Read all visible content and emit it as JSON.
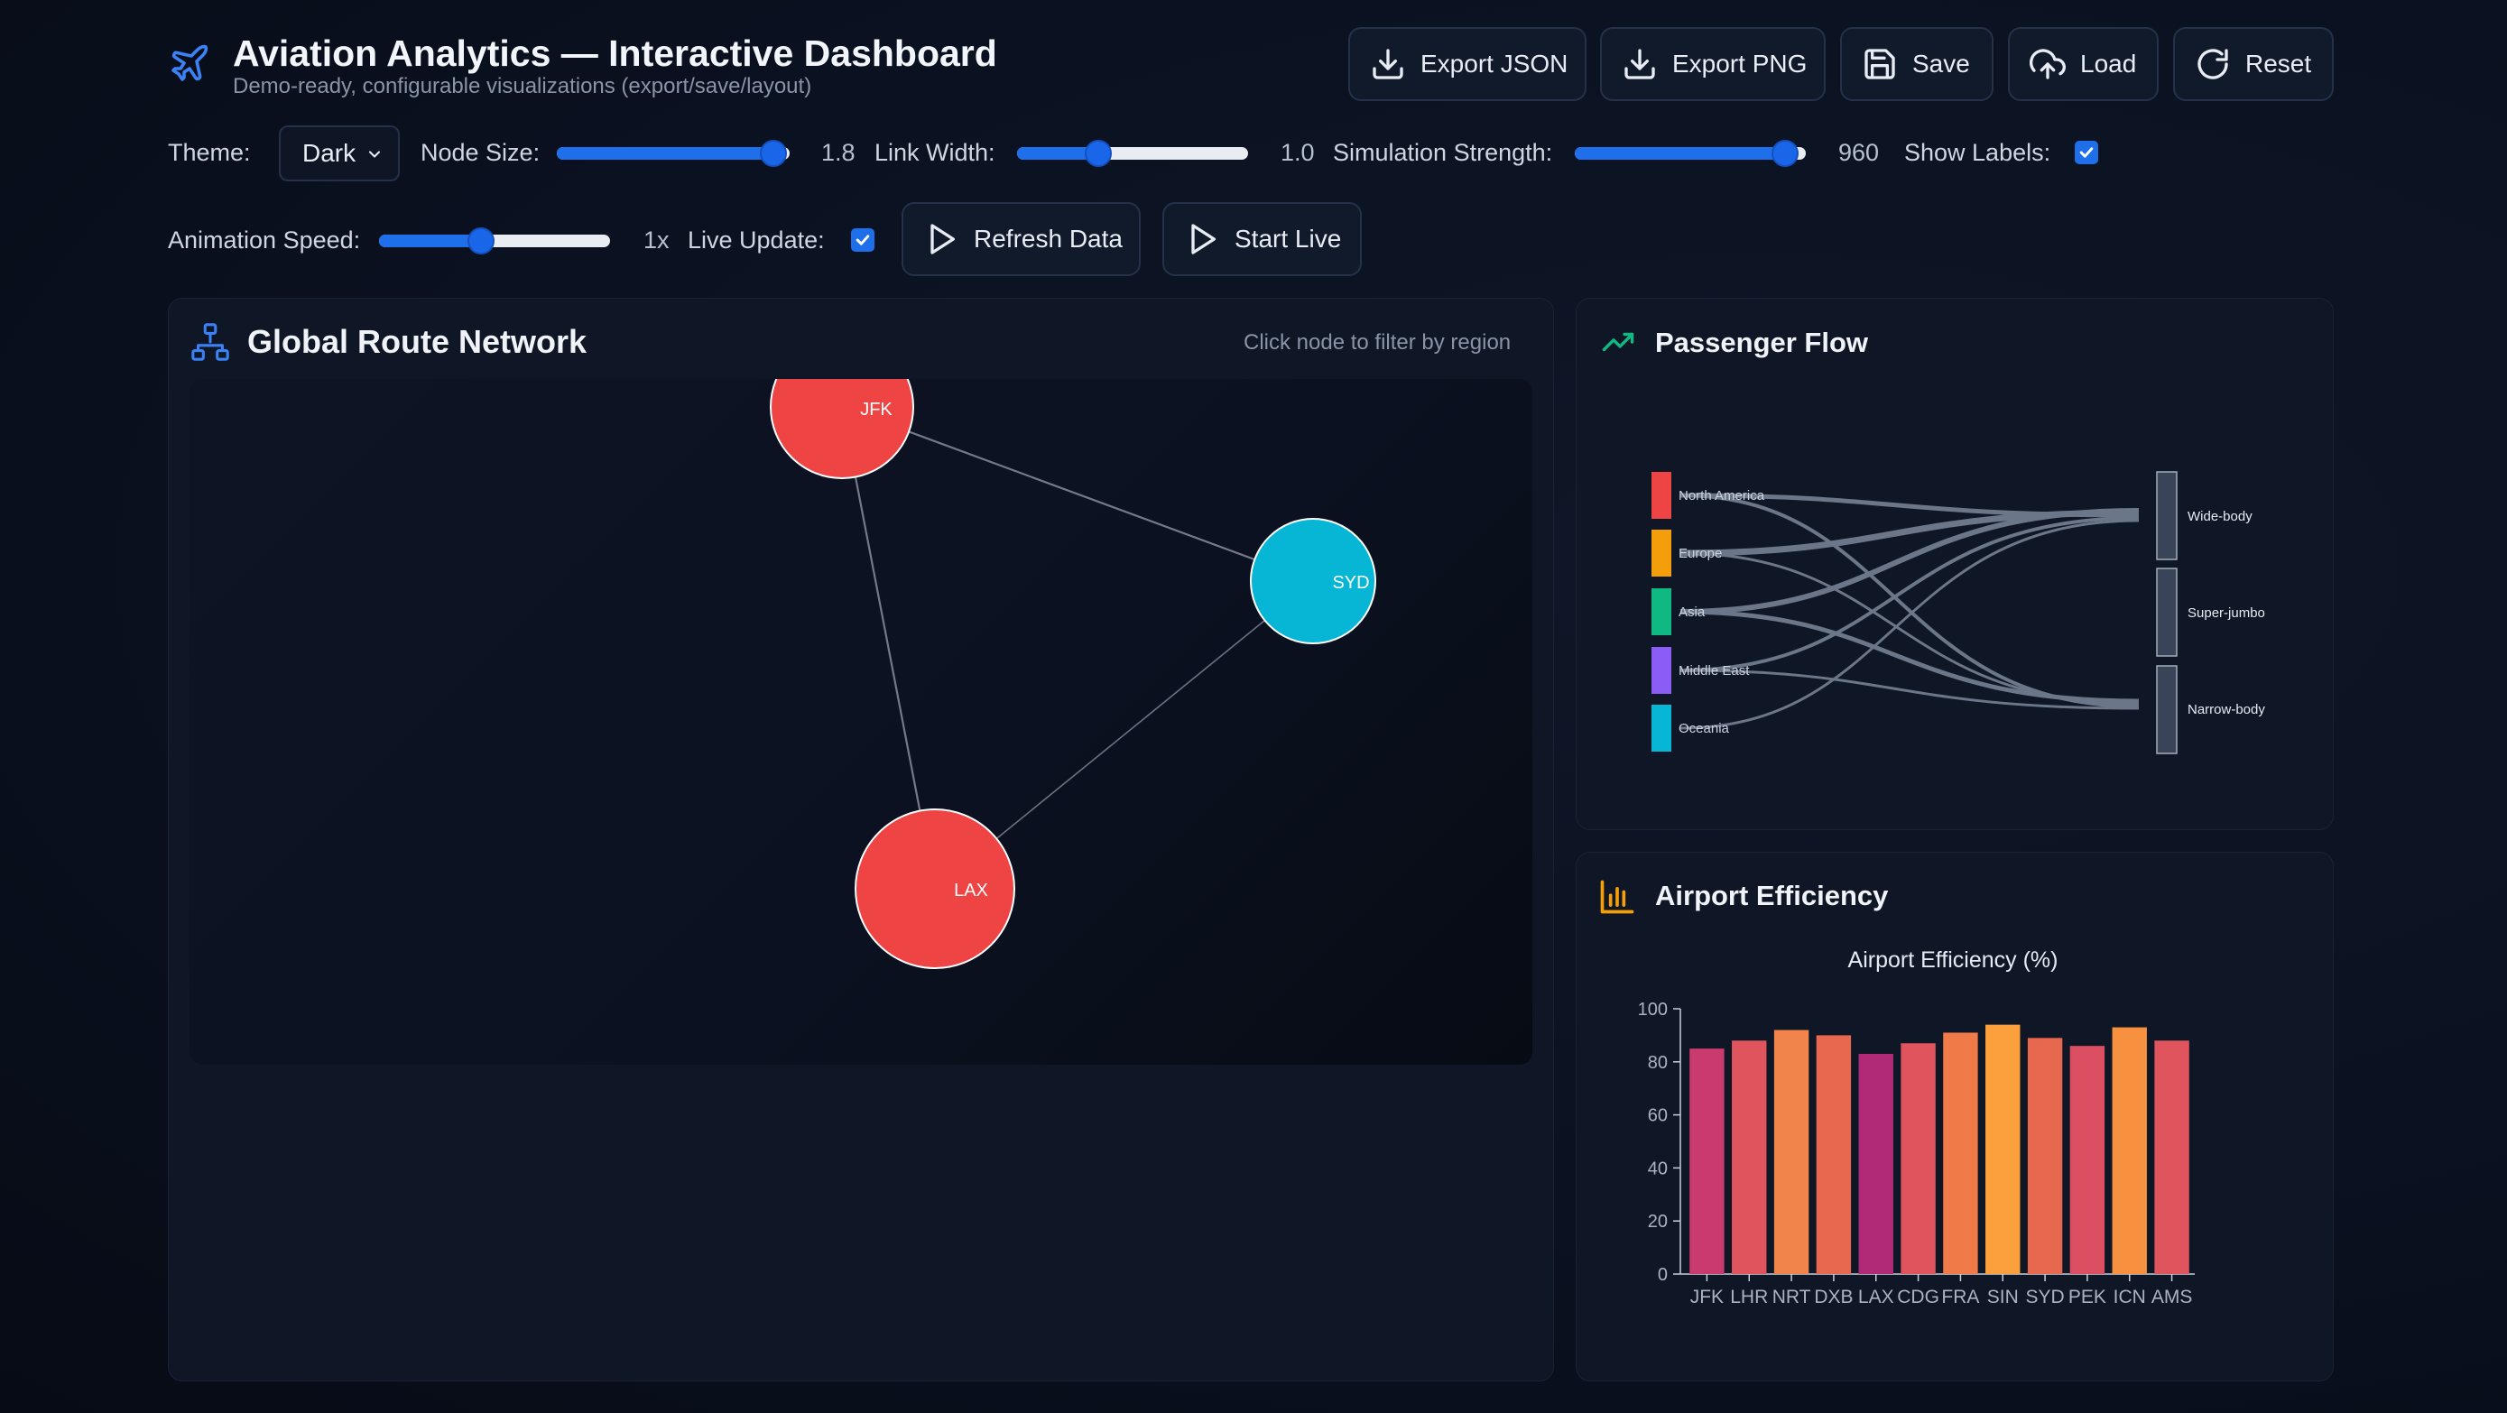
{
  "header": {
    "title": "Aviation Analytics — Interactive Dashboard",
    "subtitle": "Demo-ready, configurable visualizations (export/save/layout)",
    "icon": "airplane-icon",
    "buttons": [
      {
        "label": "Export JSON",
        "icon": "download-icon"
      },
      {
        "label": "Export PNG",
        "icon": "download-icon"
      },
      {
        "label": "Save",
        "icon": "save-icon"
      },
      {
        "label": "Load",
        "icon": "cloud-upload-icon"
      },
      {
        "label": "Reset",
        "icon": "reset-icon"
      }
    ]
  },
  "controls": {
    "theme_label": "Theme:",
    "theme_value": "Dark",
    "node_size_label": "Node Size:",
    "node_size_value": "1.8",
    "node_size_fraction": 0.93,
    "link_width_label": "Link Width:",
    "link_width_value": "1.0",
    "link_width_fraction": 0.35,
    "sim_strength_label": "Simulation Strength:",
    "sim_strength_value": "960",
    "sim_strength_fraction": 0.91,
    "show_labels_label": "Show Labels:",
    "show_labels_checked": true,
    "anim_speed_label": "Animation Speed:",
    "anim_speed_value": "1x",
    "anim_speed_fraction": 0.44,
    "live_update_label": "Live Update:",
    "live_update_checked": true,
    "refresh_label": "Refresh Data",
    "start_live_label": "Start Live"
  },
  "network": {
    "title": "Global Route Network",
    "hint": "Click node to filter by region",
    "nodes": [
      {
        "id": "JFK",
        "color": "#ef4444"
      },
      {
        "id": "SYD",
        "color": "#06b6d4"
      },
      {
        "id": "LAX",
        "color": "#ef4444"
      }
    ],
    "links": [
      [
        "JFK",
        "SYD"
      ],
      [
        "JFK",
        "LAX"
      ],
      [
        "LAX",
        "SYD"
      ]
    ]
  },
  "flow": {
    "title": "Passenger Flow",
    "sources": [
      {
        "name": "North America",
        "color": "#ef4444"
      },
      {
        "name": "Europe",
        "color": "#f59e0b"
      },
      {
        "name": "Asia",
        "color": "#10b981"
      },
      {
        "name": "Middle East",
        "color": "#8b5cf6"
      },
      {
        "name": "Oceania",
        "color": "#06b6d4"
      }
    ],
    "targets": [
      "Wide-body",
      "Super-jumbo",
      "Narrow-body"
    ]
  },
  "efficiency": {
    "title": "Airport Efficiency"
  },
  "chart_data": {
    "type": "bar",
    "title": "Airport Efficiency (%)",
    "categories": [
      "JFK",
      "LHR",
      "NRT",
      "DXB",
      "LAX",
      "CDG",
      "FRA",
      "SIN",
      "SYD",
      "PEK",
      "ICN",
      "AMS"
    ],
    "values": [
      85,
      88,
      92,
      90,
      83,
      87,
      91,
      94,
      89,
      86,
      93,
      88
    ],
    "colors": [
      "#c93a6e",
      "#e0555d",
      "#f0844a",
      "#e8674f",
      "#b02a78",
      "#e0555d",
      "#f07a48",
      "#fba03c",
      "#e8674f",
      "#dc4f62",
      "#f7913f",
      "#e0555d"
    ],
    "ylim": [
      0,
      100
    ],
    "yticks": [
      0,
      20,
      40,
      60,
      80,
      100
    ]
  }
}
